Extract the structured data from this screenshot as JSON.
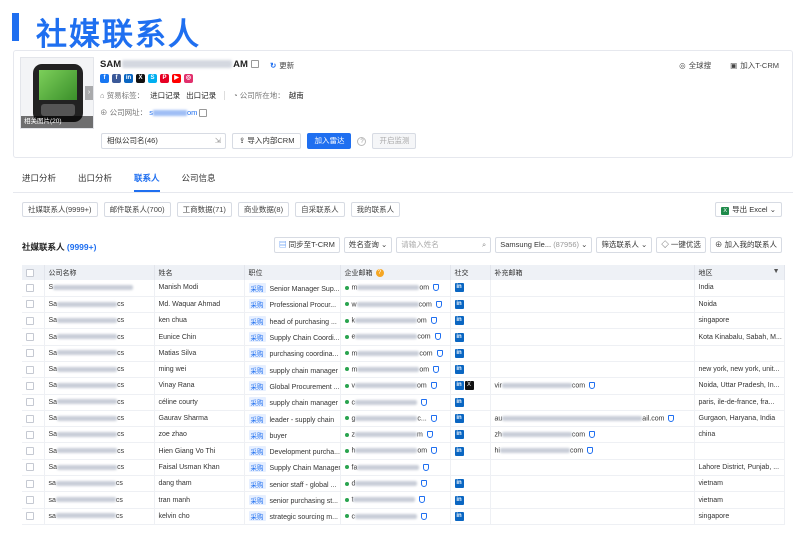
{
  "banner": {
    "title": "社媒联系人"
  },
  "company": {
    "name_prefix": "SAM",
    "name_suffix": "AM",
    "thumb_label": "相关图片(20)",
    "update_label": "更新",
    "trade_tag_label": "贸易标签：",
    "trade_tags": [
      "进口记录",
      "出口记录"
    ],
    "location_label": "公司所在地：",
    "location": "越南",
    "website_label": "公司网址：",
    "website_prefix": "s",
    "website_suffix": "om",
    "socials": [
      {
        "name": "facebook-icon",
        "color": "#1877f2",
        "glyph": "f"
      },
      {
        "name": "facebook-icon-2",
        "color": "#3b5998",
        "glyph": "f"
      },
      {
        "name": "linkedin-icon",
        "color": "#0a66c2",
        "glyph": "in"
      },
      {
        "name": "x-icon",
        "color": "#111111",
        "glyph": "X"
      },
      {
        "name": "skype-icon",
        "color": "#00aff0",
        "glyph": "S"
      },
      {
        "name": "pinterest-icon",
        "color": "#e60023",
        "glyph": "P"
      },
      {
        "name": "youtube-icon",
        "color": "#ff0000",
        "glyph": "▶"
      },
      {
        "name": "instagram-icon",
        "color": "#e1306c",
        "glyph": "◎"
      }
    ],
    "actions": {
      "global_search": "全球搜",
      "add_crm": "加入T-CRM"
    }
  },
  "similar": {
    "input_value": "相似公司名(46)",
    "import_crm": "导入内部CRM",
    "add_radar": "加入雷达",
    "start_monitor": "开启监测"
  },
  "tabs": [
    {
      "label": "进口分析",
      "active": false
    },
    {
      "label": "出口分析",
      "active": false
    },
    {
      "label": "联系人",
      "active": true
    },
    {
      "label": "公司信息",
      "active": false
    }
  ],
  "subtabs": [
    "社媒联系人(9999+)",
    "邮件联系人(700)",
    "工商数据(71)",
    "商业数据(8)",
    "自采联系人",
    "我的联系人"
  ],
  "export_label": "导出 Excel",
  "section": {
    "title": "社媒联系人",
    "count": "(9999+)"
  },
  "toolbar": {
    "sync_crm": "同步至T-CRM",
    "name_query": "姓名查询",
    "name_placeholder": "请输入姓名",
    "company_filter": "Samsung Ele...",
    "company_count": "(87956)",
    "filter_contacts": "筛选联系人",
    "one_click": "一键优选",
    "add_mine": "加入我的联系人"
  },
  "table": {
    "headers": [
      "公司名称",
      "姓名",
      "职位",
      "企业邮箱",
      "社交",
      "补充邮箱",
      "地区"
    ],
    "tag_label": "采购",
    "rows": [
      {
        "company_prefix": "S",
        "company_suffix": "",
        "name": "Manish Modi",
        "position": "Senior Manager Sup...",
        "email_prefix": "m",
        "email_suffix": "om",
        "dot": "#2aa44f",
        "social": [
          "in"
        ],
        "extra_prefix": "",
        "extra_suffix": "",
        "region": "India"
      },
      {
        "company_prefix": "Sa",
        "company_suffix": "cs",
        "name": "Md. Waquar Ahmad",
        "position": "Professional Procur...",
        "email_prefix": "w",
        "email_suffix": "com",
        "dot": "#2aa44f",
        "social": [
          "in"
        ],
        "extra_prefix": "",
        "extra_suffix": "",
        "region": "Noida"
      },
      {
        "company_prefix": "Sa",
        "company_suffix": "cs",
        "name": "ken chua",
        "position": "head of purchasing ...",
        "email_prefix": "k",
        "email_suffix": "om",
        "dot": "#2aa44f",
        "social": [
          "in"
        ],
        "extra_prefix": "",
        "extra_suffix": "",
        "region": "singapore"
      },
      {
        "company_prefix": "Sa",
        "company_suffix": "cs",
        "name": "Eunice Chin",
        "position": "Supply Chain Coordi...",
        "email_prefix": "e",
        "email_suffix": "com",
        "dot": "#2aa44f",
        "social": [
          "in"
        ],
        "extra_prefix": "",
        "extra_suffix": "",
        "region": "Kota Kinabalu, Sabah, M..."
      },
      {
        "company_prefix": "Sa",
        "company_suffix": "cs",
        "name": "Matias Silva",
        "position": "purchasing coordina...",
        "email_prefix": "m",
        "email_suffix": "com",
        "dot": "#2aa44f",
        "social": [
          "in"
        ],
        "extra_prefix": "",
        "extra_suffix": "",
        "region": ""
      },
      {
        "company_prefix": "Sa",
        "company_suffix": "cs",
        "name": "ming wei",
        "position": "supply chain manager",
        "email_prefix": "m",
        "email_suffix": "om",
        "dot": "#2aa44f",
        "social": [
          "in"
        ],
        "extra_prefix": "",
        "extra_suffix": "",
        "region": "new york, new york, unit..."
      },
      {
        "company_prefix": "Sa",
        "company_suffix": "cs",
        "name": "Vinay Rana",
        "position": "Global Procurement ...",
        "email_prefix": "v",
        "email_suffix": "om",
        "dot": "#2aa44f",
        "social": [
          "in",
          "x"
        ],
        "extra_prefix": "vir",
        "extra_suffix": "com",
        "region": "Noida, Uttar Pradesh, In..."
      },
      {
        "company_prefix": "Sa",
        "company_suffix": "cs",
        "name": "céline courty",
        "position": "supply chain manager",
        "email_prefix": "c",
        "email_suffix": "",
        "dot": "#2aa44f",
        "social": [
          "in"
        ],
        "extra_prefix": "",
        "extra_suffix": "",
        "region": "paris, ile-de-france, fra..."
      },
      {
        "company_prefix": "Sa",
        "company_suffix": "cs",
        "name": "Gaurav Sharma",
        "position": "leader - supply chain",
        "email_prefix": "g",
        "email_suffix": "c...",
        "dot": "#2aa44f",
        "social": [
          "in"
        ],
        "extra_prefix": "au",
        "extra_suffix": "ail.com",
        "region": "Gurgaon, Haryana, India"
      },
      {
        "company_prefix": "Sa",
        "company_suffix": "cs",
        "name": "zoe zhao",
        "position": "buyer",
        "email_prefix": "z",
        "email_suffix": "m",
        "dot": "#2aa44f",
        "social": [
          "in"
        ],
        "extra_prefix": "zh",
        "extra_suffix": "com",
        "region": "china"
      },
      {
        "company_prefix": "Sa",
        "company_suffix": "cs",
        "name": "Hien Giang Vo Thi",
        "position": "Development purcha...",
        "email_prefix": "h",
        "email_suffix": "om",
        "dot": "#2aa44f",
        "social": [
          "in"
        ],
        "extra_prefix": "hi",
        "extra_suffix": "com",
        "region": ""
      },
      {
        "company_prefix": "Sa",
        "company_suffix": "cs",
        "name": "Faisal Usman Khan",
        "position": "Supply Chain Manager",
        "email_prefix": "fa",
        "email_suffix": "",
        "dot": "#2aa44f",
        "social": [],
        "extra_prefix": "",
        "extra_suffix": "",
        "region": "Lahore District, Punjab, ..."
      },
      {
        "company_prefix": "sa",
        "company_suffix": "cs",
        "name": "dang tham",
        "position": "senior staff - global ...",
        "email_prefix": "d",
        "email_suffix": "",
        "dot": "#2aa44f",
        "social": [
          "in"
        ],
        "extra_prefix": "",
        "extra_suffix": "",
        "region": "vietnam"
      },
      {
        "company_prefix": "sa",
        "company_suffix": "cs",
        "name": "tran manh",
        "position": "senior purchasing st...",
        "email_prefix": "t",
        "email_suffix": "",
        "dot": "#2aa44f",
        "social": [
          "in"
        ],
        "extra_prefix": "",
        "extra_suffix": "",
        "region": "vietnam"
      },
      {
        "company_prefix": "sa",
        "company_suffix": "cs",
        "name": "kelvin cho",
        "position": "strategic sourcing m...",
        "email_prefix": "c",
        "email_suffix": "",
        "dot": "#2aa44f",
        "social": [
          "in"
        ],
        "extra_prefix": "",
        "extra_suffix": "",
        "region": "singapore"
      }
    ]
  }
}
